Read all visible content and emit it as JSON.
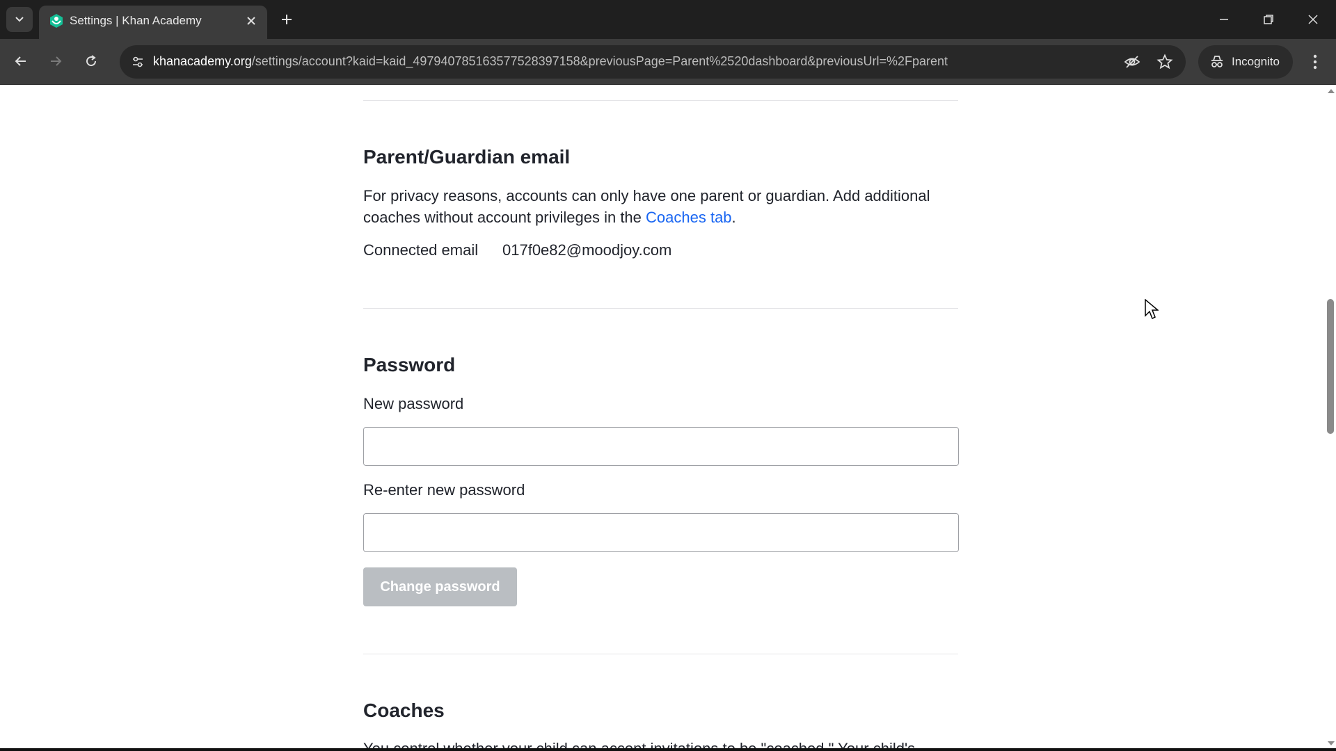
{
  "browser": {
    "tab_title": "Settings | Khan Academy",
    "url_host": "khanacademy.org",
    "url_path": "/settings/account?kaid=kaid_497940785163577528397158&previousPage=Parent%2520dashboard&previousUrl=%2Fparent",
    "incognito_label": "Incognito",
    "accent_color": "#14bf96"
  },
  "page": {
    "guardian": {
      "heading": "Parent/Guardian email",
      "description_before": "For privacy reasons, accounts can only have one parent or guardian. Add additional coaches without account privileges in the ",
      "coaches_link": "Coaches tab",
      "description_after": ".",
      "connected_label": "Connected email",
      "connected_value": "017f0e82@moodjoy.com"
    },
    "password": {
      "heading": "Password",
      "new_label": "New password",
      "new_value": "",
      "reenter_label": "Re-enter new password",
      "reenter_value": "",
      "change_button": "Change password"
    },
    "coaches": {
      "heading": "Coaches",
      "partial_text": "You control whether your child can accept invitations to be \"coached.\" Your child's"
    }
  }
}
